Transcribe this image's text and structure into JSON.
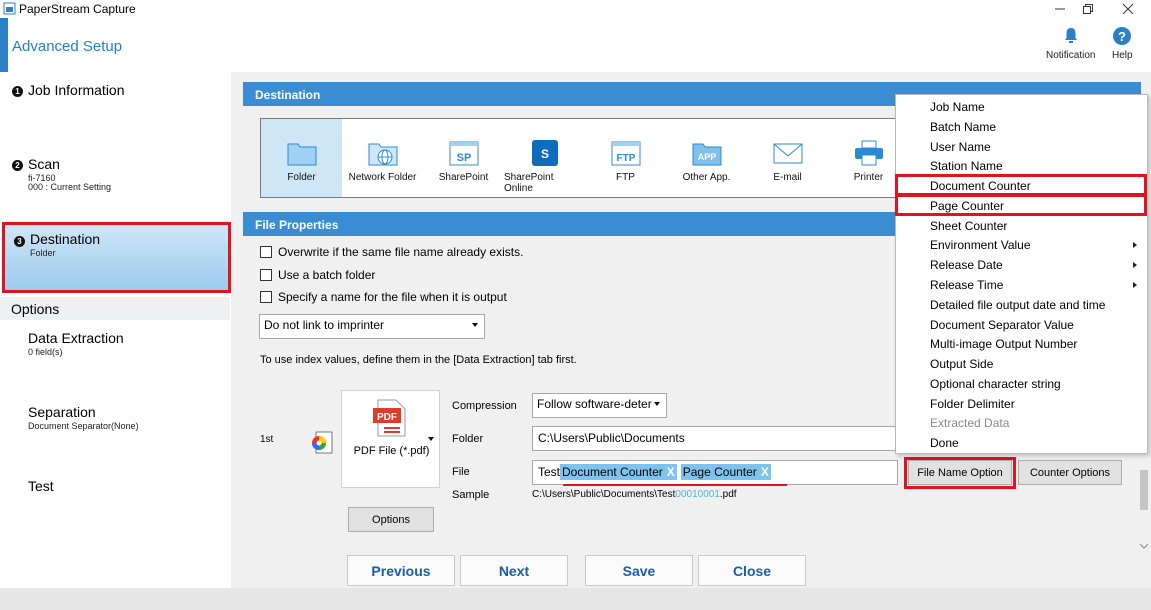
{
  "app": {
    "title": "PaperStream Capture",
    "header_title": "Advanced Setup",
    "notification_label": "Notification",
    "help_label": "Help"
  },
  "nav": {
    "steps": [
      {
        "num": "1",
        "title": "Job Information",
        "sub1": "",
        "sub2": ""
      },
      {
        "num": "2",
        "title": "Scan",
        "sub1": "fi-7160",
        "sub2": "000 : Current Setting"
      },
      {
        "num": "3",
        "title": "Destination",
        "sub1": "Folder",
        "sub2": ""
      }
    ],
    "options_heading": "Options",
    "options": [
      {
        "title": "Data Extraction",
        "sub": "0 field(s)"
      },
      {
        "title": "Separation",
        "sub": "Document Separator(None)"
      },
      {
        "title": "Test",
        "sub": ""
      }
    ]
  },
  "destination": {
    "heading": "Destination",
    "items": [
      "Folder",
      "Network Folder",
      "SharePoint",
      "SharePoint Online",
      "FTP",
      "Other App.",
      "E-mail",
      "Printer"
    ],
    "selected": "Folder",
    "sharepoint_glyph": "SP",
    "ftp_glyph": "FTP",
    "app_glyph": "APP"
  },
  "file_properties": {
    "heading": "File Properties",
    "checks": [
      "Overwrite if the same file name already exists.",
      "Use a batch folder",
      "Specify a name for the file when it is output"
    ],
    "imprinter_select": "Do not link to imprinter",
    "index_note": "To use index values, define them in the [Data Extraction] tab first.",
    "row_label": "1st",
    "format_label": "PDF File (*.pdf)",
    "pdf_glyph": "PDF",
    "compression_label": "Compression",
    "compression_value": "Follow software-deter",
    "folder_label": "Folder",
    "folder_value": "C:\\Users\\Public\\Documents",
    "file_label": "File",
    "file_prefix": "Test",
    "file_tags": [
      "Document Counter",
      "Page Counter"
    ],
    "sample_label": "Sample",
    "sample_prefix": "C:\\Users\\Public\\Documents\\Test",
    "sample_counter": "00010001",
    "sample_ext": ".pdf",
    "options_button": "Options",
    "file_name_option_button": "File Name Option",
    "counter_options_button": "Counter Options",
    "tag_close": "X"
  },
  "menu": {
    "items": [
      {
        "label": "Job Name",
        "submenu": false,
        "disabled": false
      },
      {
        "label": "Batch Name",
        "submenu": false,
        "disabled": false
      },
      {
        "label": "User Name",
        "submenu": false,
        "disabled": false
      },
      {
        "label": "Station Name",
        "submenu": false,
        "disabled": false
      },
      {
        "label": "Document Counter",
        "submenu": false,
        "disabled": false
      },
      {
        "label": "Page Counter",
        "submenu": false,
        "disabled": false
      },
      {
        "label": "Sheet Counter",
        "submenu": false,
        "disabled": false
      },
      {
        "label": "Environment Value",
        "submenu": true,
        "disabled": false
      },
      {
        "label": "Release Date",
        "submenu": true,
        "disabled": false
      },
      {
        "label": "Release Time",
        "submenu": true,
        "disabled": false
      },
      {
        "label": "Detailed file output date and time",
        "submenu": false,
        "disabled": false
      },
      {
        "label": "Document Separator Value",
        "submenu": false,
        "disabled": false
      },
      {
        "label": "Multi-image Output Number",
        "submenu": false,
        "disabled": false
      },
      {
        "label": "Output Side",
        "submenu": false,
        "disabled": false
      },
      {
        "label": "Optional character string",
        "submenu": false,
        "disabled": false
      },
      {
        "label": "Folder Delimiter",
        "submenu": false,
        "disabled": false
      },
      {
        "label": "Extracted Data",
        "submenu": false,
        "disabled": true
      },
      {
        "label": "Done",
        "submenu": false,
        "disabled": false
      }
    ]
  },
  "footer": {
    "previous": "Previous",
    "next": "Next",
    "save": "Save",
    "close": "Close"
  }
}
